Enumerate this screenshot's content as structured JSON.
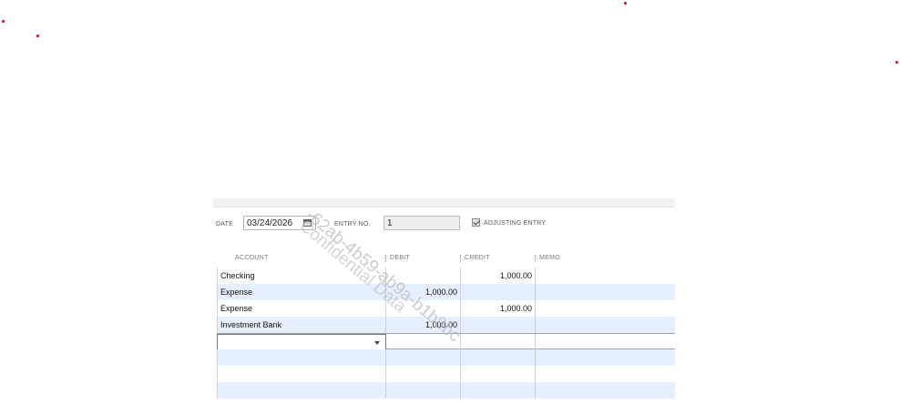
{
  "form": {
    "date_label": "DATE",
    "date_value": "03/24/2026",
    "entry_no_label": "ENTRY NO.",
    "entry_no_value": "1",
    "adjusting_label": "ADJUSTING ENTRY",
    "adjusting_checked": true
  },
  "table": {
    "headers": {
      "account": "ACCOUNT",
      "debit": "DEBIT",
      "credit": "CREDIT",
      "memo": "MEMO"
    },
    "rows": [
      {
        "account": "Checking",
        "debit": "",
        "credit": "1,000.00",
        "memo": ""
      },
      {
        "account": "Expense",
        "debit": "1,000.00",
        "credit": "",
        "memo": ""
      },
      {
        "account": "Expense",
        "debit": "",
        "credit": "1,000.00",
        "memo": ""
      },
      {
        "account": "Investment Bank",
        "debit": "1,000.00",
        "credit": "",
        "memo": ""
      }
    ]
  },
  "watermark": {
    "line1": "-62ab-4b59-ab9a-b1b8bc",
    "line2": "Confidential Data"
  },
  "colors": {
    "row_alt": "#e5efff",
    "marker_dot": "#d0021b"
  }
}
